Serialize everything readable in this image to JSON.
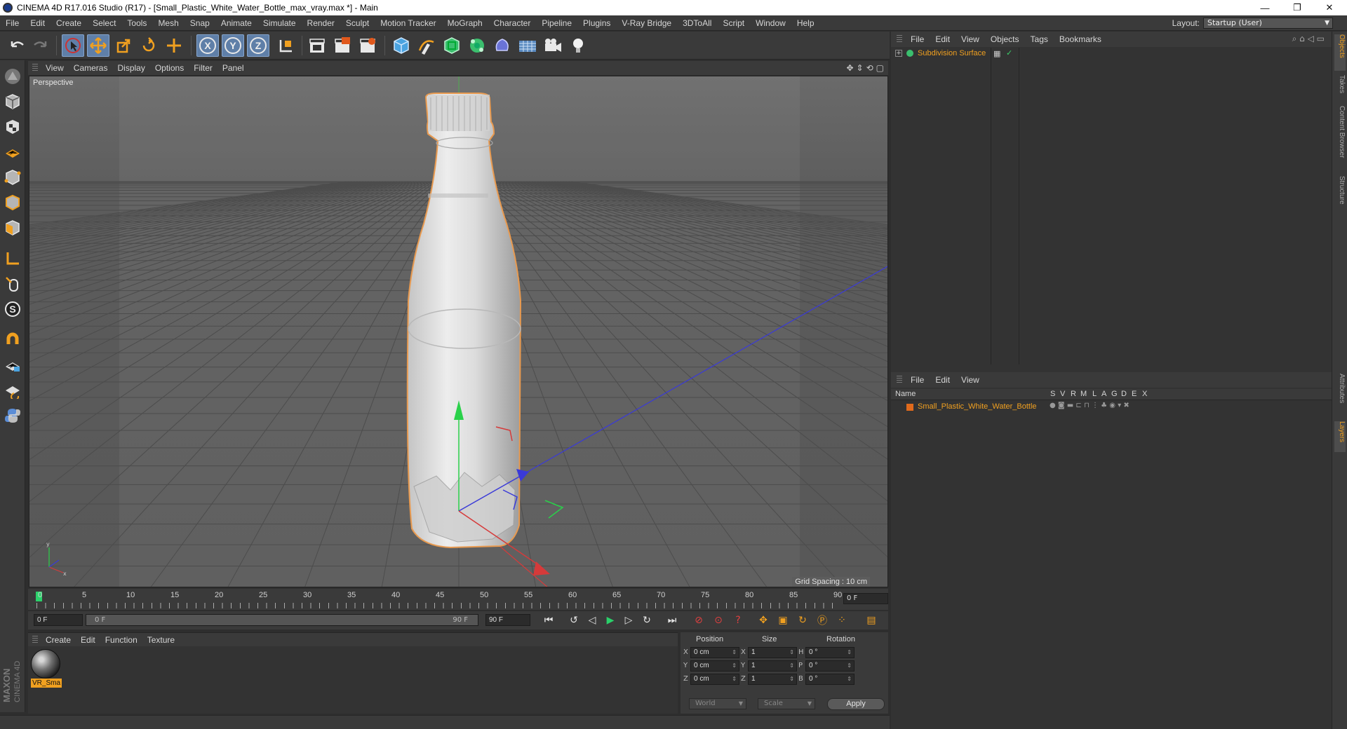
{
  "window": {
    "title": "CINEMA 4D R17.016 Studio (R17) - [Small_Plastic_White_Water_Bottle_max_vray.max *] - Main",
    "controls": [
      "—",
      "❐",
      "✕"
    ]
  },
  "menubar": {
    "items": [
      "File",
      "Edit",
      "Create",
      "Select",
      "Tools",
      "Mesh",
      "Snap",
      "Animate",
      "Simulate",
      "Render",
      "Sculpt",
      "Motion Tracker",
      "MoGraph",
      "Character",
      "Pipeline",
      "Plugins",
      "V-Ray Bridge",
      "3DToAll",
      "Script",
      "Window",
      "Help"
    ],
    "layout_label": "Layout:",
    "layout_value": "Startup (User)"
  },
  "toolbar": {
    "axis_x": "X",
    "axis_y": "Y",
    "axis_z": "Z"
  },
  "viewport": {
    "menu": [
      "View",
      "Cameras",
      "Display",
      "Options",
      "Filter",
      "Panel"
    ],
    "label": "Perspective",
    "grid_spacing": "Grid Spacing : 10 cm"
  },
  "timeline": {
    "ticks": [
      "0",
      "5",
      "10",
      "15",
      "20",
      "25",
      "30",
      "35",
      "40",
      "45",
      "50",
      "55",
      "60",
      "65",
      "70",
      "75",
      "80",
      "85",
      "90"
    ],
    "frame_end_box": "0 F",
    "start_field": "0 F",
    "range_start": "0 F",
    "range_end": "90 F",
    "end_field": "90 F"
  },
  "material_manager": {
    "menu": [
      "Create",
      "Edit",
      "Function",
      "Texture"
    ],
    "material_name": "VR_Sma"
  },
  "coordinates": {
    "headers": {
      "position": "Position",
      "size": "Size",
      "rotation": "Rotation"
    },
    "rows": [
      {
        "axis": "X",
        "pos": "0 cm",
        "size_axis": "X",
        "size": "1",
        "rot_axis": "H",
        "rot": "0 °"
      },
      {
        "axis": "Y",
        "pos": "0 cm",
        "size_axis": "Y",
        "size": "1",
        "rot_axis": "P",
        "rot": "0 °"
      },
      {
        "axis": "Z",
        "pos": "0 cm",
        "size_axis": "Z",
        "size": "1",
        "rot_axis": "B",
        "rot": "0 °"
      }
    ],
    "mode_world": "World",
    "mode_scale": "Scale",
    "apply": "Apply"
  },
  "object_manager": {
    "menu": [
      "File",
      "Edit",
      "View",
      "Objects",
      "Tags",
      "Bookmarks"
    ],
    "objects": [
      {
        "name": "Subdivision Surface"
      }
    ]
  },
  "layer_manager": {
    "menu": [
      "File",
      "Edit",
      "View"
    ],
    "columns": [
      "Name",
      "S",
      "V",
      "R",
      "M",
      "L",
      "A",
      "G",
      "D",
      "E",
      "X"
    ],
    "layers": [
      {
        "name": "Small_Plastic_White_Water_Bottle",
        "color": "#e06a1c"
      }
    ]
  },
  "side_tabs": [
    "Objects",
    "Takes",
    "Content Browser",
    "Structure",
    "Attributes",
    "Layers"
  ],
  "maxon": {
    "line1": "MAXON",
    "line2": "CINEMA 4D"
  },
  "colors": {
    "accent_orange": "#f0a020",
    "active_blue": "#5f7fa8",
    "play_green": "#2ad16a"
  }
}
